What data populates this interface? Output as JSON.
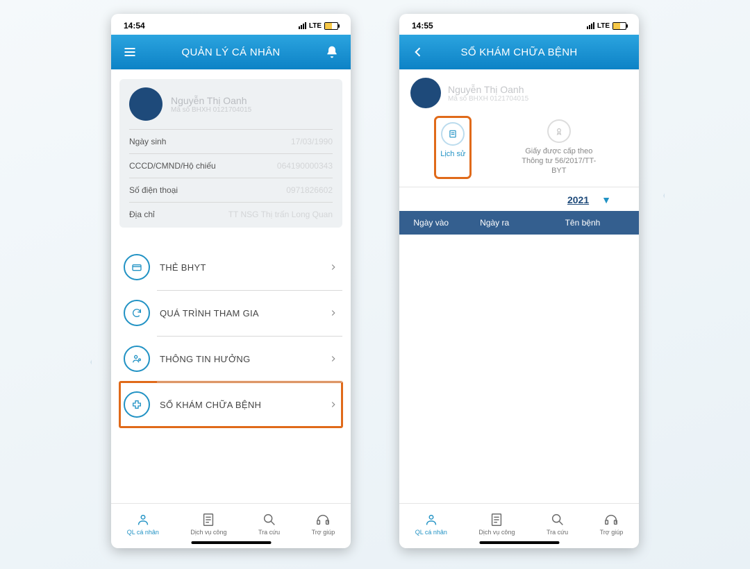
{
  "left": {
    "status_time": "14:54",
    "network": "LTE",
    "title": "QUẢN LÝ CÁ NHÂN",
    "profile": {
      "name": "Nguyễn Thị Oanh",
      "sub": "Mã số BHXH 0121704015",
      "fields": [
        {
          "k": "Ngày sinh",
          "v": "17/03/1990"
        },
        {
          "k": "CCCD/CMND/Hộ chiếu",
          "v": "064190000343"
        },
        {
          "k": "Số điện thoại",
          "v": "0971826602"
        },
        {
          "k": "Địa chỉ",
          "v": "TT NSG Thị trấn Long Quan"
        }
      ]
    },
    "menu": [
      {
        "icon": "card",
        "label": "THẺ BHYT"
      },
      {
        "icon": "refresh",
        "label": "QUÁ TRÌNH THAM GIA"
      },
      {
        "icon": "person",
        "label": "THÔNG TIN HƯỞNG"
      },
      {
        "icon": "plus",
        "label": "SỔ KHÁM CHỮA BỆNH",
        "highlight": true
      }
    ]
  },
  "right": {
    "status_time": "14:55",
    "network": "LTE",
    "title": "SỔ KHÁM CHỮA BỆNH",
    "profile": {
      "name": "Nguyễn Thị Oanh",
      "sub": "Mã số BHXH 0121704015"
    },
    "segments": {
      "history": "Lịch sử",
      "cert": "Giấy được cấp theo Thông tư 56/2017/TT-BYT"
    },
    "year": "2021",
    "columns": {
      "c1": "Ngày vào",
      "c2": "Ngày ra",
      "c3": "Tên bệnh"
    }
  },
  "tabs": {
    "t1": "QL cá nhân",
    "t2": "Dịch vụ công",
    "t3": "Tra cứu",
    "t4": "Trợ giúp"
  }
}
